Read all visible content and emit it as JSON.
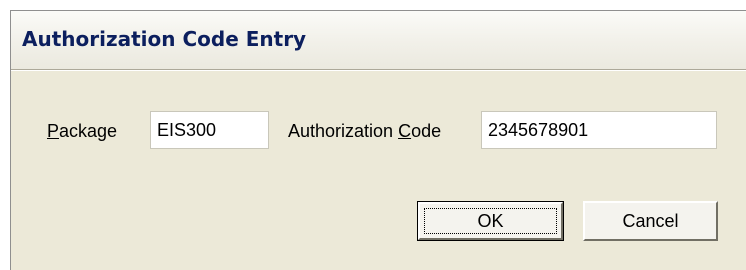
{
  "dialog": {
    "title": "Authorization Code Entry"
  },
  "package": {
    "label_mnemonic": "P",
    "label_rest": "ackage",
    "value": "EIS300"
  },
  "authorization": {
    "label_before": "Authorization ",
    "label_mnemonic": "C",
    "label_rest": "ode",
    "value": "2345678901"
  },
  "buttons": {
    "ok_label": "OK",
    "cancel_label": "Cancel"
  }
}
